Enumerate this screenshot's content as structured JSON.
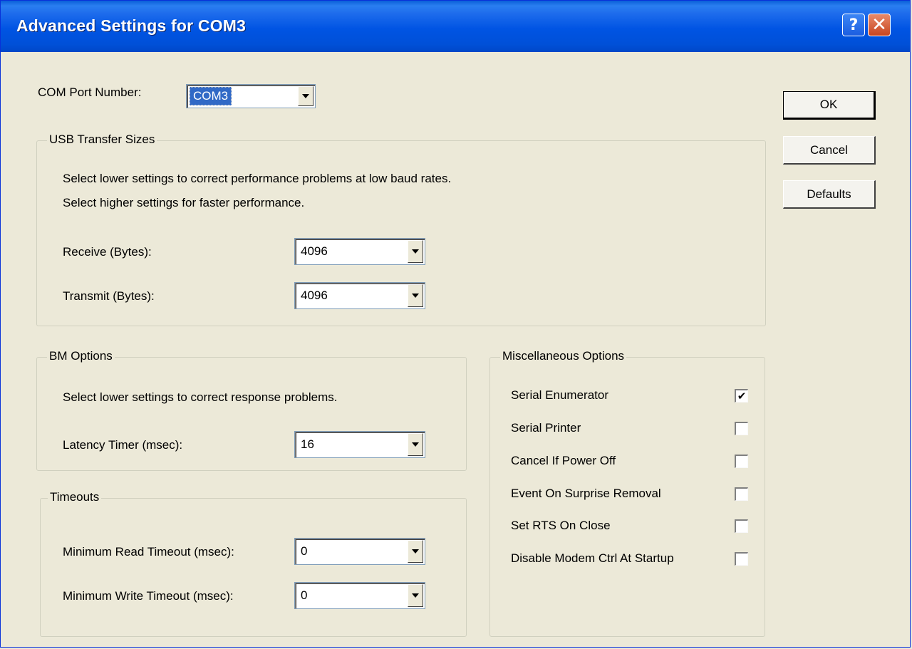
{
  "window": {
    "title": "Advanced Settings for COM3"
  },
  "com_port": {
    "label": "COM Port Number:",
    "value": "COM3"
  },
  "usb_transfer": {
    "legend": "USB Transfer Sizes",
    "desc1": "Select lower settings to correct performance problems at low baud rates.",
    "desc2": "Select higher settings for faster performance.",
    "receive_label": "Receive (Bytes):",
    "receive_value": "4096",
    "transmit_label": "Transmit (Bytes):",
    "transmit_value": "4096"
  },
  "bm_options": {
    "legend": "BM Options",
    "desc": "Select lower settings to correct response problems.",
    "latency_label": "Latency Timer (msec):",
    "latency_value": "16"
  },
  "timeouts": {
    "legend": "Timeouts",
    "read_label": "Minimum Read Timeout (msec):",
    "read_value": "0",
    "write_label": "Minimum Write Timeout (msec):",
    "write_value": "0"
  },
  "misc": {
    "legend": "Miscellaneous Options",
    "items": [
      {
        "label": "Serial Enumerator",
        "checked": true
      },
      {
        "label": "Serial Printer",
        "checked": false
      },
      {
        "label": "Cancel If Power Off",
        "checked": false
      },
      {
        "label": "Event On Surprise Removal",
        "checked": false
      },
      {
        "label": "Set RTS On Close",
        "checked": false
      },
      {
        "label": "Disable Modem Ctrl At Startup",
        "checked": false
      }
    ]
  },
  "buttons": {
    "ok": "OK",
    "cancel": "Cancel",
    "defaults": "Defaults"
  },
  "titlebar_buttons": {
    "help": "?",
    "close": "✕"
  },
  "colors": {
    "titlebar": "#0054e3",
    "dialog_bg": "#ece9d8",
    "selection": "#3169c6"
  }
}
